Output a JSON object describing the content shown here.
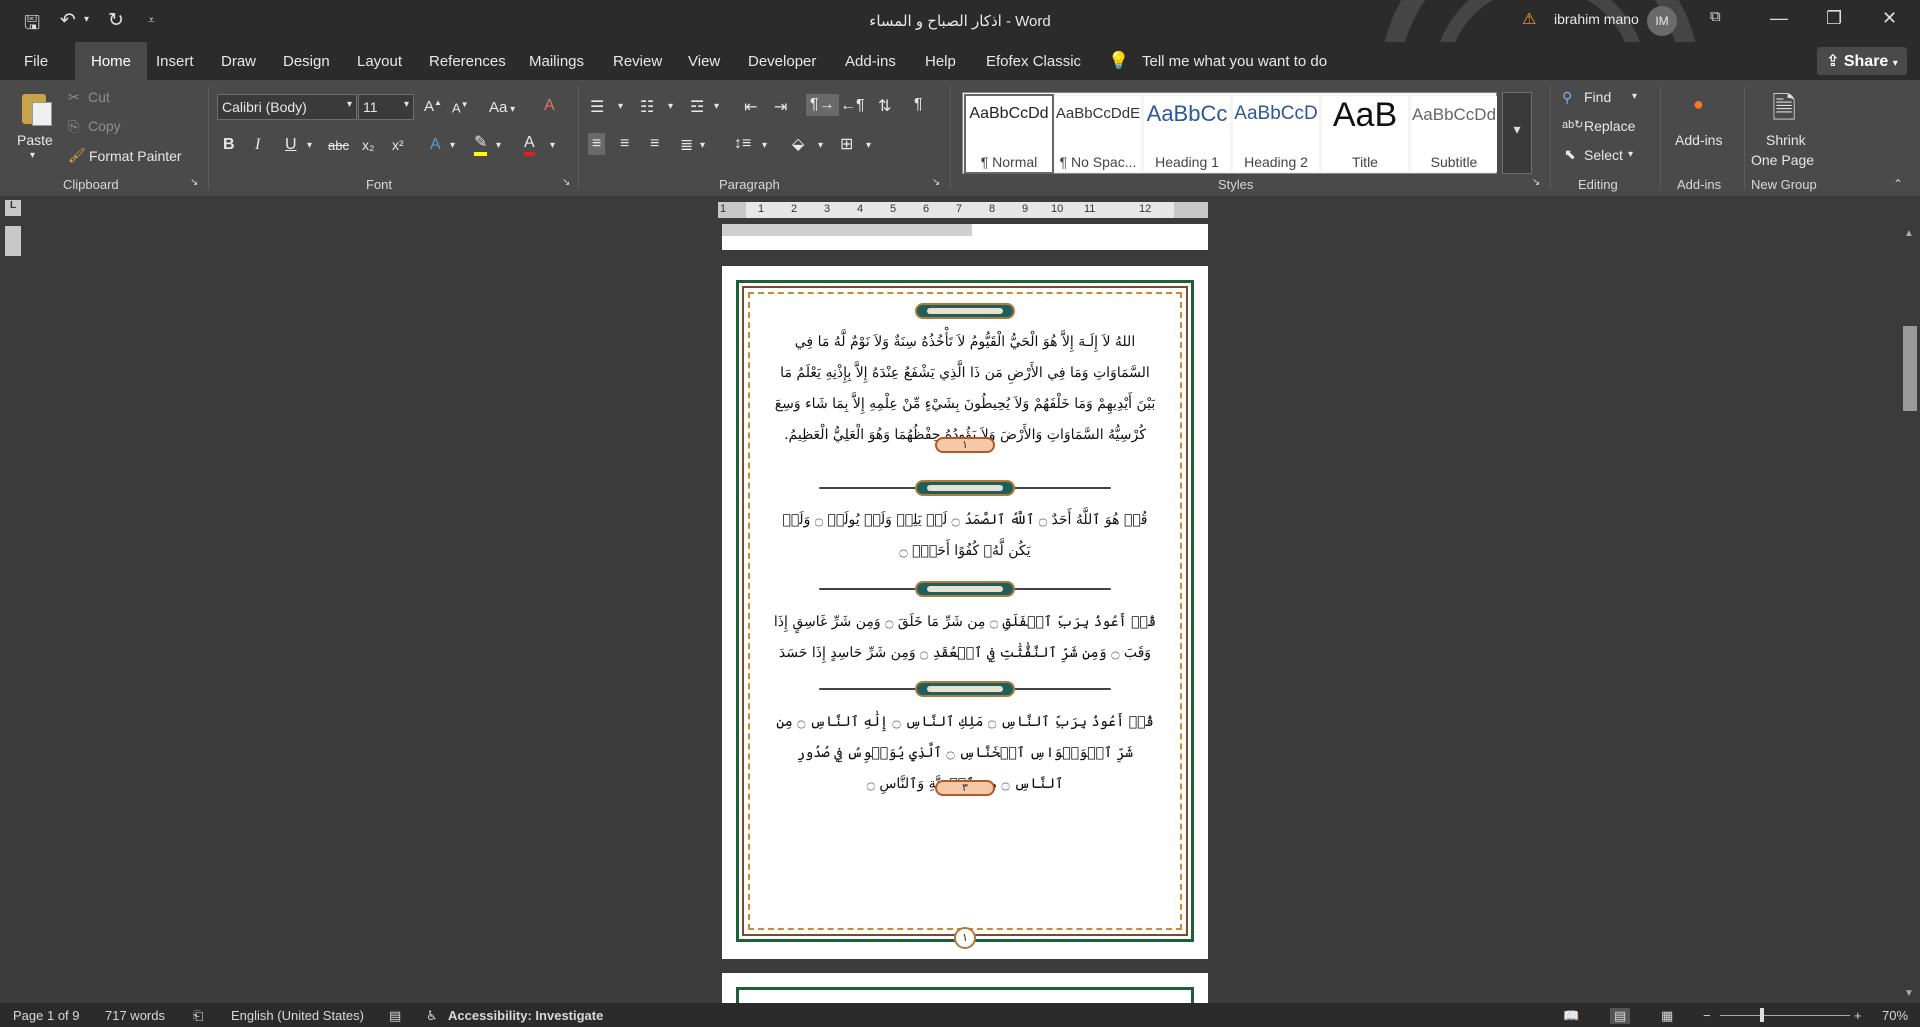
{
  "window": {
    "title": "اذكار الصباح و المساء  -  Word",
    "user_name": "ibrahim mano",
    "user_initials": "IM",
    "warning_icon": "warning-icon"
  },
  "menu": {
    "file": "File",
    "tabs": [
      "Home",
      "Insert",
      "Draw",
      "Design",
      "Layout",
      "References",
      "Mailings",
      "Review",
      "View",
      "Developer",
      "Add-ins",
      "Help",
      "Efofex Classic"
    ],
    "tell_me": "Tell me what you want to do",
    "share": "Share"
  },
  "ribbon": {
    "clipboard": {
      "paste": "Paste",
      "cut": "Cut",
      "copy": "Copy",
      "format_painter": "Format Painter",
      "label": "Clipboard"
    },
    "font": {
      "family": "Calibri (Body)",
      "size": "11",
      "label": "Font",
      "case_label": "Aa",
      "bold": "B",
      "italic": "I",
      "underline": "U",
      "strike": "abc",
      "sub": "x₂",
      "sup": "x²"
    },
    "paragraph": {
      "label": "Paragraph"
    },
    "styles": {
      "label": "Styles",
      "items": [
        {
          "preview": "AaBbCcDd",
          "name": "¶ Normal"
        },
        {
          "preview": "AaBbCcDdE",
          "name": "¶ No Spac..."
        },
        {
          "preview": "AaBbCc",
          "name": "Heading 1"
        },
        {
          "preview": "AaBbCcD",
          "name": "Heading 2"
        },
        {
          "preview": "AaB",
          "name": "Title"
        },
        {
          "preview": "AaBbCcDd",
          "name": "Subtitle"
        }
      ]
    },
    "editing": {
      "find": "Find",
      "replace": "Replace",
      "select": "Select",
      "label": "Editing"
    },
    "addins": {
      "button": "Add-ins",
      "label": "Add-ins"
    },
    "new_group": {
      "button_line1": "Shrink",
      "button_line2": "One Page",
      "label": "New Group"
    }
  },
  "ruler": {
    "numbers": [
      "1",
      "1",
      "2",
      "3",
      "4",
      "5",
      "6",
      "7",
      "8",
      "9",
      "10",
      "11",
      "12"
    ]
  },
  "document": {
    "para1": "اللهُ لاَ إِلَـهَ إِلاَّ هُوَ الْحَيُّ الْقَيُّومُ لاَ تَأْخُذُهُ سِنَةٌ وَلاَ نَوْمٌ لَّهُ مَا فِي السَّمَاوَاتِ وَمَا فِي الأَرْضِ مَن ذَا الَّذِي يَشْفَعُ عِنْدَهُ إِلاَّ بِإِذْنِهِ يَعْلَمُ مَا بَيْنَ أَيْدِيهِمْ وَمَا خَلْفَهُمْ وَلاَ يُحِيطُونَ بِشَيْءٍ مِّنْ عِلْمِهِ إِلاَّ بِمَا شَاء وَسِعَ كُرْسِيُّهُ السَّمَاوَاتِ وَالأَرْضَ وَلاَ يَؤُودُهُ حِفْظُهُمَا وَهُوَ الْعَلِيُّ الْعَظِيمُ.",
    "badge1": "١",
    "para2": "قُلۡ هُوَ ٱللَّهُ أَحَدٌ ۝ ٱللَّهُ ٱلصَّمَدُ ۝ لَمۡ يَلِدۡ وَلَمۡ يُولَدۡ ۝ وَلَمۡ يَكُن لَّهُۥ كُفُوًا أَحَدُۢ ۝",
    "para3": "قُلۡ أَعُوذُ بِرَبِّ ٱلۡفَلَقِ ۝ مِن شَرِّ مَا خَلَقَ ۝ وَمِن شَرِّ غَاسِقٍ إِذَا وَقَبَ ۝ وَمِن شَرِّ ٱلنَّفَّٰثَٰتِ فِي ٱلۡعُقَدِ ۝ وَمِن شَرِّ حَاسِدٍ إِذَا حَسَدَ ۝",
    "para4": "قُلۡ أَعُوذُ بِرَبِّ ٱلنَّاسِ ۝ مَلِكِ ٱلنَّاسِ ۝ إِلَٰهِ ٱلنَّاسِ ۝ مِن شَرِّ ٱلۡوَسۡوَاسِ ٱلۡخَنَّاسِ ۝ ٱلَّذِي يُوَسۡوِسُ فِي صُدُورِ ٱلنَّاسِ ۝ مِنَ ٱلۡجِنَّةِ وَٱلنَّاسِ ۝",
    "badge3": "٣",
    "page_number": "١"
  },
  "status": {
    "page": "Page 1 of 9",
    "words": "717 words",
    "language": "English (United States)",
    "accessibility": "Accessibility: Investigate",
    "zoom": "70%"
  },
  "colors": {
    "titlebar": "#2b2b2b",
    "ribbon": "#4a4a4a",
    "workspace": "#3b3b3b",
    "frame_green": "#1e5f37",
    "frame_gold": "#b07a3a"
  }
}
